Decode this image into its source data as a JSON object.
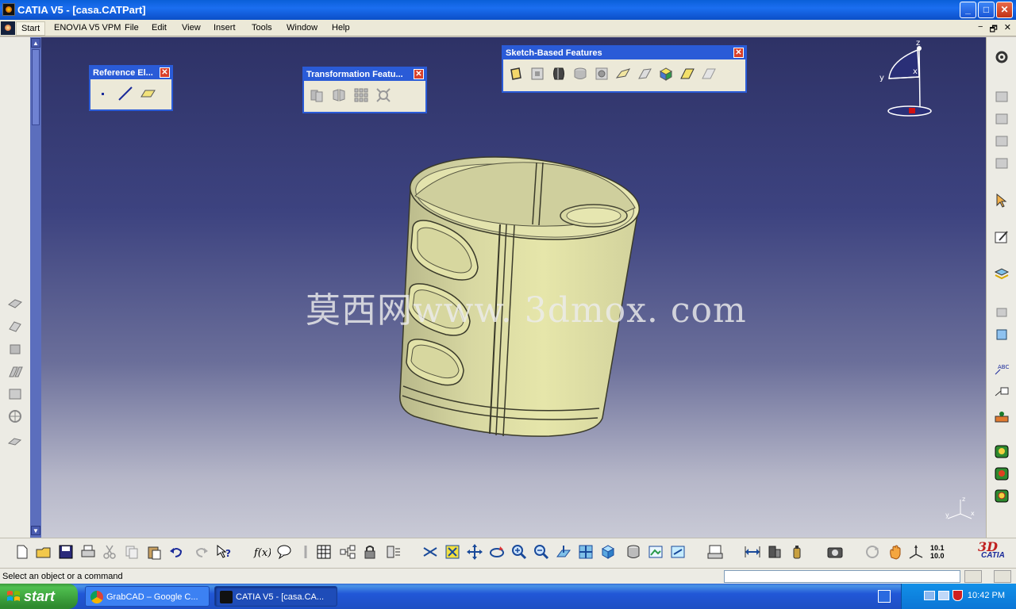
{
  "window": {
    "title": "CATIA V5 - [casa.CATPart]",
    "buttons": {
      "minimize": "_",
      "maximize": "□",
      "close": "✕"
    }
  },
  "menubar": {
    "items": [
      "Start",
      "ENOVIA V5 VPM",
      "File",
      "Edit",
      "View",
      "Insert",
      "Tools",
      "Window",
      "Help"
    ],
    "mdi_buttons": [
      "−",
      "🗗",
      "✕"
    ]
  },
  "toolbars": {
    "reference": {
      "title": "Reference El...",
      "icons": [
        "point-icon",
        "line-icon",
        "plane-icon"
      ]
    },
    "transformation": {
      "title": "Transformation Featu...",
      "icons": [
        "translation-icon",
        "mirror-icon",
        "rectangular-pattern-icon",
        "scaling-icon"
      ]
    },
    "sketch_based": {
      "title": "Sketch-Based Features",
      "icons": [
        "pad-icon",
        "pocket-icon",
        "shaft-icon",
        "groove-icon",
        "hole-icon",
        "rib-icon",
        "slot-icon",
        "multi-sections-solid-icon",
        "stiffener-icon",
        "removed-multi-sections-icon"
      ]
    }
  },
  "viewport": {
    "watermark": "莫西网www. 3dmox. com",
    "compass_labels": {
      "z": "z",
      "y": "y",
      "x": "x"
    },
    "axis_labels": {
      "z": "z",
      "y": "y",
      "x": "x"
    }
  },
  "statusbar": {
    "message": "Select an object or a command"
  },
  "bottom_toolbar": {
    "icons": [
      "new-icon",
      "open-icon",
      "save-icon",
      "print-icon",
      "cut-icon",
      "copy-icon",
      "paste-icon",
      "undo-icon",
      "redo-icon",
      "whats-this-icon",
      "formula-icon",
      "knowledge-advisor-icon",
      "measure-icon",
      "table-icon",
      "tree-expand-icon",
      "lock-icon",
      "catalog-icon",
      "fly-mode-icon",
      "fit-all-icon",
      "pan-icon",
      "rotate-icon",
      "zoom-in-icon",
      "zoom-out-icon",
      "normal-view-icon",
      "multi-view-icon",
      "iso-view-icon",
      "shading-icon",
      "hide-show-icon",
      "swap-space-icon",
      "analysis-icon",
      "measure-between-icon",
      "mass-props-icon",
      "inertia-icon",
      "capture-icon",
      "refresh-icon",
      "hand-icon",
      "axis-icon"
    ],
    "scale_text": "10.1 10.0",
    "brand": "CATIA"
  },
  "taskbar": {
    "start_label": "start",
    "tasks": [
      {
        "label": "GrabCAD – Google C..."
      },
      {
        "label": "CATIA V5 - [casa.CA..."
      }
    ],
    "clock": "10:42 PM"
  },
  "colors": {
    "titlebar": "#1b6ef0",
    "viewport_top": "#2e3266",
    "viewport_bottom": "#c9cad6",
    "part_fill": "#e6e6a8",
    "taskbar": "#2157d7",
    "start_button": "#3c9a3c"
  }
}
